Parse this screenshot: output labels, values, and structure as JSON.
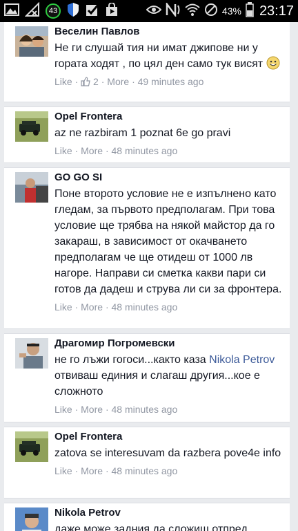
{
  "status_bar": {
    "notification_count": "43",
    "battery": "43%",
    "time": "23:17"
  },
  "comments": [
    {
      "author": "Веселин Павлов",
      "text": "Не ги слушай тия ни имат джипове ни у гората ходят , по цял ден само тук висят",
      "like": "Like",
      "likes_count": "2",
      "more": "More",
      "time": "49 minutes ago"
    },
    {
      "author": "Opel Frontera",
      "text": "az ne razbiram 1 poznat 6e go pravi",
      "like": "Like",
      "more": "More",
      "time": "48 minutes ago"
    },
    {
      "author": "GO GO SI",
      "text": "Поне второто условие не е изпълнено като гледам, за първото предполагам. При това условие ще трябва на някой майстор да го закараш, в зависимост от окачването предполагам че ще отидеш от 1000 лв нагоре. Направи си сметка какви пари си готов да дадеш и струва ли си за фронтера.",
      "like": "Like",
      "more": "More",
      "time": "48 minutes ago"
    },
    {
      "author": "Драгомир Погромевски",
      "text_before": "не го лъжи гогоси...както каза ",
      "mention": "Nikola Petrov",
      "text_after": " отвиваш единия и слагаш другия...кое е сложното",
      "like": "Like",
      "more": "More",
      "time": "48 minutes ago"
    },
    {
      "author": "Opel Frontera",
      "text": "zatova se interesuvam da razbera pove4e info",
      "like": "Like",
      "more": "More",
      "time": "48 minutes ago"
    },
    {
      "author": "Nikola Petrov",
      "text": "даже може задния да сложиш отпред"
    }
  ]
}
